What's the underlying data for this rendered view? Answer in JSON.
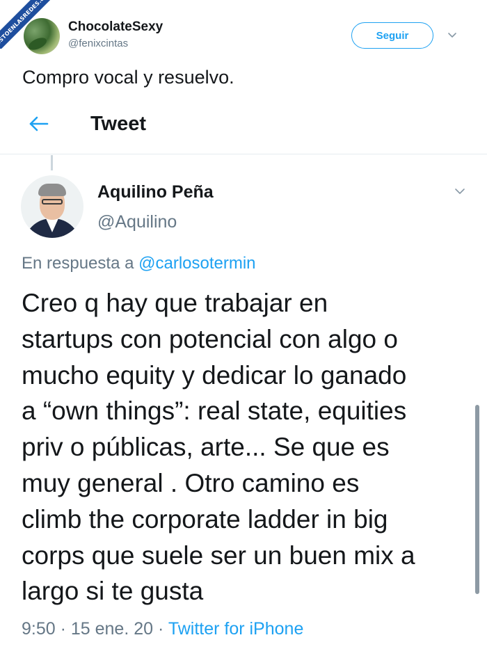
{
  "watermark": {
    "text": "VISTOENLASREDES.com"
  },
  "outer_tweet": {
    "author_name": "ChocolateSexy",
    "author_handle": "@fenixcintas",
    "follow_label": "Seguir",
    "text": "Compro vocal y resuelvo."
  },
  "header": {
    "title": "Tweet"
  },
  "inner_tweet": {
    "author_name": "Aquilino Peña",
    "author_handle": "@Aquilino",
    "reply_prefix": "En respuesta a ",
    "reply_mention": "@carlosotermin",
    "body": "Creo q hay que trabajar en\nstartups con potencial con algo o\nmucho equity y dedicar lo ganado\na “own things”: real state, equities\npriv o públicas, arte... Se que es\nmuy general . Otro camino es\nclimb the corporate ladder in big\ncorps que suele ser un buen mix a\nlargo si te gusta",
    "time_date": "9:50 · 15 ene. 20 · ",
    "source": "Twitter for iPhone"
  },
  "colors": {
    "accent": "#1da1f2",
    "secondary_text": "#657786",
    "primary_text": "#14171a",
    "watermark_band": "#1e4e9e"
  },
  "icons": {
    "back": "arrow-left-icon",
    "menu": "chevron-down-icon"
  }
}
